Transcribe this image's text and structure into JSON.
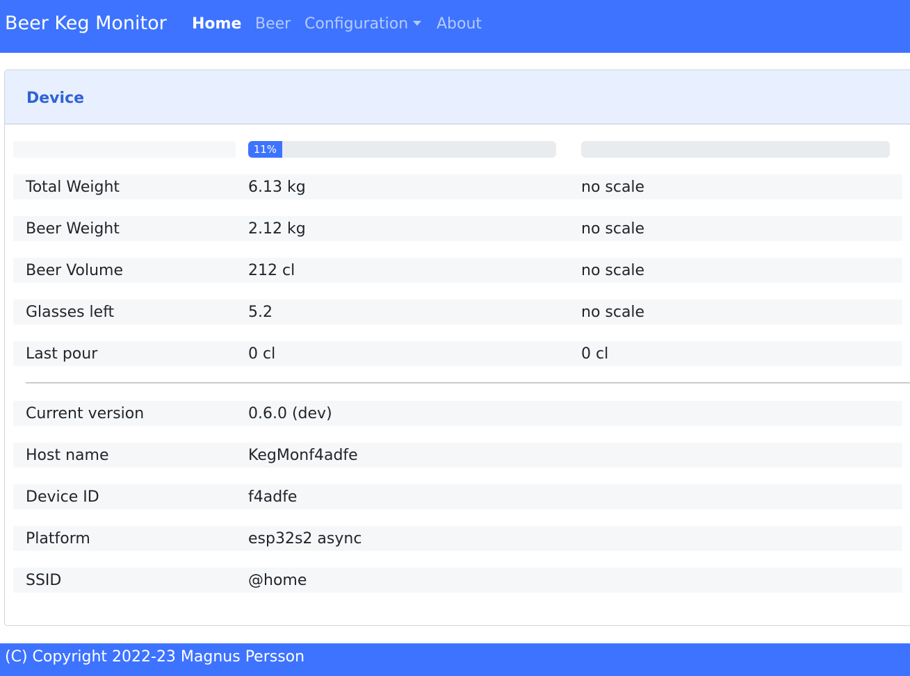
{
  "navbar": {
    "brand": "Beer Keg Monitor",
    "items": [
      {
        "label": "Home"
      },
      {
        "label": "Beer"
      },
      {
        "label": "Configuration"
      },
      {
        "label": "About"
      }
    ]
  },
  "device_card": {
    "title": "Device",
    "progress": [
      {
        "value_percent": 11,
        "label": "11%"
      },
      {
        "value_percent": 0,
        "label": ""
      }
    ],
    "scale_rows": [
      {
        "label": "Total Weight",
        "scale1": "6.13 kg",
        "scale2": "no scale"
      },
      {
        "label": "Beer Weight",
        "scale1": "2.12 kg",
        "scale2": "no scale"
      },
      {
        "label": "Beer Volume",
        "scale1": "212 cl",
        "scale2": "no scale"
      },
      {
        "label": "Glasses left",
        "scale1": "5.2",
        "scale2": "no scale"
      },
      {
        "label": "Last pour",
        "scale1": "0 cl",
        "scale2": "0 cl"
      }
    ],
    "info_rows": [
      {
        "label": "Current version",
        "value": "0.6.0 (dev)"
      },
      {
        "label": "Host name",
        "value": "KegMonf4adfe"
      },
      {
        "label": "Device ID",
        "value": "f4adfe"
      },
      {
        "label": "Platform",
        "value": "esp32s2 async"
      },
      {
        "label": "SSID",
        "value": "@home"
      }
    ]
  },
  "footer": {
    "text": "(C) Copyright 2022-23 Magnus Persson"
  },
  "colors": {
    "primary": "#3d73fe",
    "header_bg": "#e8effe",
    "row_bg": "#f6f7f9"
  }
}
